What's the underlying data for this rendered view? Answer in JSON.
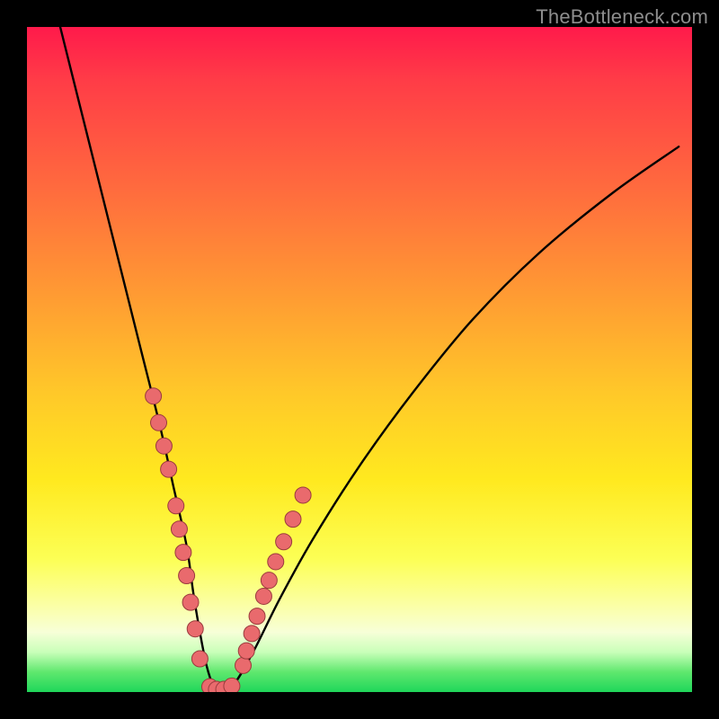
{
  "watermark": "TheBottleneck.com",
  "chart_data": {
    "type": "line",
    "title": "",
    "xlabel": "",
    "ylabel": "",
    "xlim": [
      0,
      100
    ],
    "ylim": [
      0,
      100
    ],
    "annotations": [],
    "series": [
      {
        "name": "bottleneck-curve",
        "x": [
          5,
          8,
          11,
          14,
          17,
          20,
          22,
          24,
          25,
          26,
          27,
          28,
          29,
          31,
          34,
          38,
          43,
          50,
          58,
          67,
          77,
          88,
          98
        ],
        "y": [
          100,
          88,
          76,
          64,
          52,
          40,
          31,
          22,
          15,
          9,
          4,
          1,
          0,
          1,
          6,
          14,
          23,
          34,
          45,
          56,
          66,
          75,
          82
        ]
      }
    ],
    "markers": [
      {
        "name": "left-arm-dots",
        "x": [
          19.0,
          19.8,
          20.6,
          21.3,
          22.4,
          22.9,
          23.5,
          24.0,
          24.6,
          25.3,
          26.0
        ],
        "y": [
          44.5,
          40.5,
          37.0,
          33.5,
          28.0,
          24.5,
          21.0,
          17.5,
          13.5,
          9.5,
          5.0
        ]
      },
      {
        "name": "bottom-dots",
        "x": [
          27.5,
          28.5,
          29.6,
          30.8
        ],
        "y": [
          0.8,
          0.4,
          0.4,
          0.9
        ]
      },
      {
        "name": "right-arm-dots",
        "x": [
          32.5,
          33.0,
          33.8,
          34.6,
          35.6,
          36.4,
          37.4,
          38.6,
          40.0,
          41.5
        ],
        "y": [
          4.0,
          6.2,
          8.8,
          11.4,
          14.4,
          16.8,
          19.6,
          22.6,
          26.0,
          29.6
        ]
      }
    ],
    "gradient_stops": [
      {
        "pos": 0,
        "color": "#ff1a4b"
      },
      {
        "pos": 8,
        "color": "#ff3c47"
      },
      {
        "pos": 24,
        "color": "#ff6a3e"
      },
      {
        "pos": 40,
        "color": "#ff9a33"
      },
      {
        "pos": 55,
        "color": "#ffc829"
      },
      {
        "pos": 68,
        "color": "#ffe91f"
      },
      {
        "pos": 80,
        "color": "#fcff55"
      },
      {
        "pos": 87,
        "color": "#fbffa6"
      },
      {
        "pos": 91,
        "color": "#f7ffd8"
      },
      {
        "pos": 94,
        "color": "#c9ffb9"
      },
      {
        "pos": 97,
        "color": "#5fe86e"
      },
      {
        "pos": 100,
        "color": "#1fd65a"
      }
    ],
    "colors": {
      "curve": "#000000",
      "marker_fill": "#e96a6d",
      "marker_stroke": "#9a3b3d",
      "frame": "#000000"
    }
  }
}
